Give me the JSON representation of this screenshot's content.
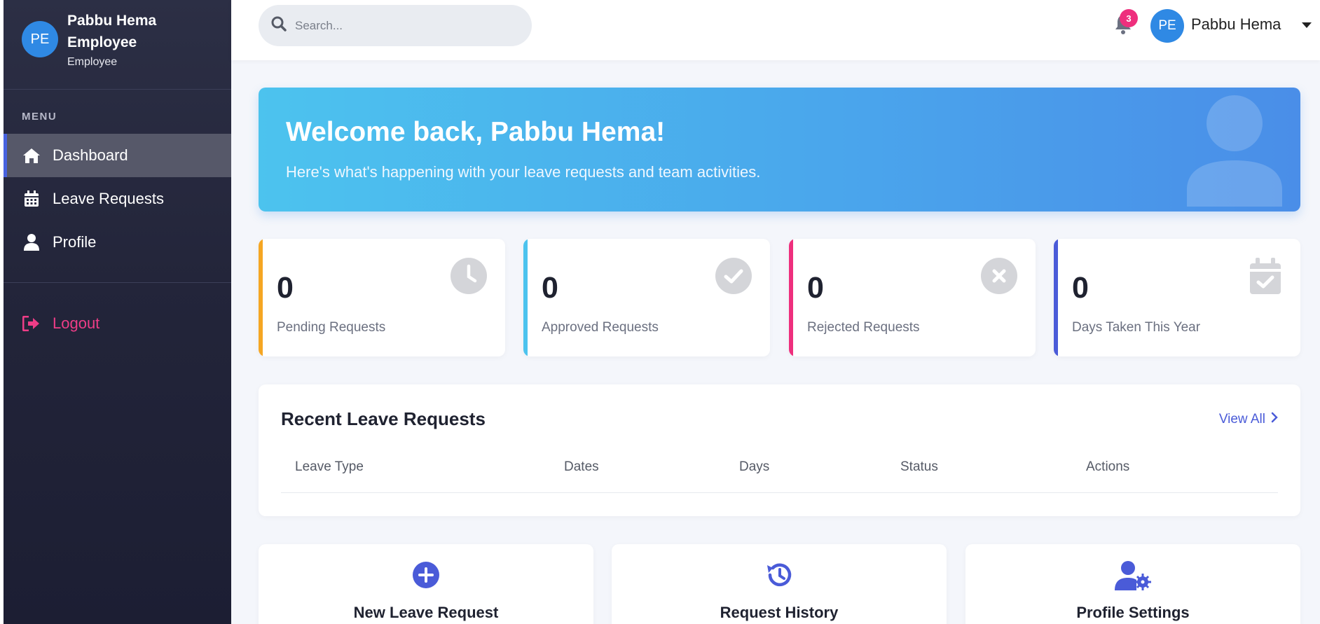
{
  "sidebar": {
    "avatar_initials": "PE",
    "user_name": "Pabbu Hema Employee",
    "user_role": "Employee",
    "menu_label": "MENU",
    "items": [
      {
        "label": "Dashboard",
        "icon": "home-icon",
        "active": true
      },
      {
        "label": "Leave Requests",
        "icon": "calendar-icon",
        "active": false
      },
      {
        "label": "Profile",
        "icon": "user-icon",
        "active": false
      }
    ],
    "logout_label": "Logout"
  },
  "topbar": {
    "search_placeholder": "Search...",
    "notification_count": "3",
    "avatar_initials": "PE",
    "user_name": "Pabbu Hema"
  },
  "welcome": {
    "title": "Welcome back, Pabbu Hema!",
    "subtitle": "Here's what's happening with your leave requests and team activities."
  },
  "stats": [
    {
      "value": "0",
      "label": "Pending Requests",
      "color": "#f5a623",
      "icon": "clock-icon"
    },
    {
      "value": "0",
      "label": "Approved Requests",
      "color": "#4cc3ee",
      "icon": "check-circle-icon"
    },
    {
      "value": "0",
      "label": "Rejected Requests",
      "color": "#ee2f7d",
      "icon": "x-circle-icon"
    },
    {
      "value": "0",
      "label": "Days Taken This Year",
      "color": "#4a5bd8",
      "icon": "calendar-check-icon"
    }
  ],
  "recent": {
    "title": "Recent Leave Requests",
    "view_all": "View All",
    "columns": [
      "Leave Type",
      "Dates",
      "Days",
      "Status",
      "Actions"
    ]
  },
  "quick_actions": [
    {
      "label": "New Leave Request",
      "icon": "plus-circle-icon"
    },
    {
      "label": "Request History",
      "icon": "history-icon"
    },
    {
      "label": "Profile Settings",
      "icon": "user-cog-icon"
    }
  ],
  "colors": {
    "accent": "#4a5bd8",
    "logout": "#ee3d87"
  }
}
